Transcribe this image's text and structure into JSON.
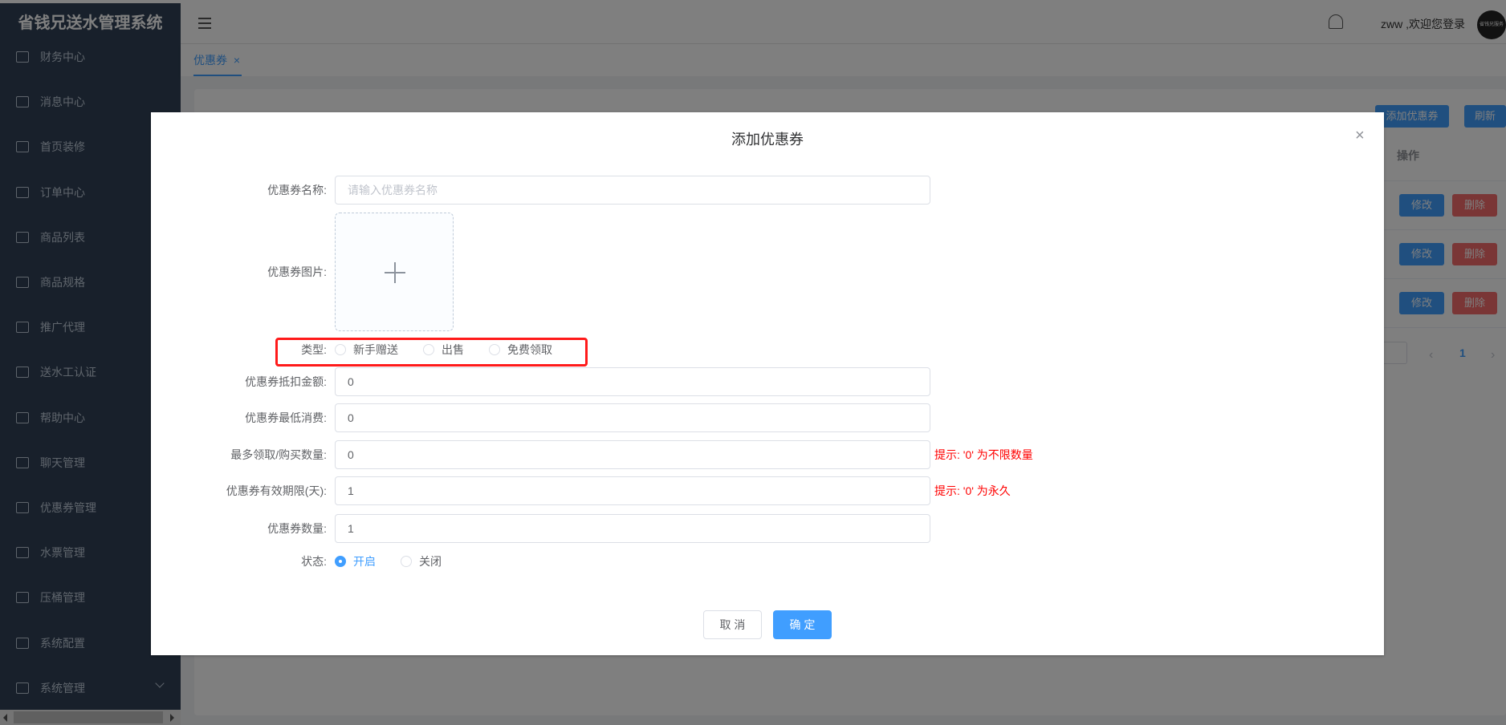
{
  "app_title": "省钱兄送水管理系统",
  "sidebar": {
    "items": [
      {
        "label": "财务中心",
        "icon": "wallet-icon"
      },
      {
        "label": "消息中心",
        "icon": "message-icon"
      },
      {
        "label": "首页装修",
        "icon": "box-icon"
      },
      {
        "label": "订单中心",
        "icon": "document-icon"
      },
      {
        "label": "商品列表",
        "icon": "clipboard-icon"
      },
      {
        "label": "商品规格",
        "icon": "list-card-icon"
      },
      {
        "label": "推广代理",
        "icon": "trophy-icon"
      },
      {
        "label": "送水工认证",
        "icon": "box-icon"
      },
      {
        "label": "帮助中心",
        "icon": "list-icon"
      },
      {
        "label": "聊天管理",
        "icon": "message-icon"
      },
      {
        "label": "优惠券管理",
        "icon": "ticket-icon"
      },
      {
        "label": "水票管理",
        "icon": "list-card-icon"
      },
      {
        "label": "压桶管理",
        "icon": "grid-icon"
      },
      {
        "label": "系统配置",
        "icon": "list-icon"
      },
      {
        "label": "系统管理",
        "icon": "list-icon"
      }
    ]
  },
  "header": {
    "user_greeting": "zww ,欢迎您登录",
    "avatar_text": "省钱兄服务"
  },
  "tabs": [
    {
      "label": "优惠券",
      "close": "×"
    }
  ],
  "background": {
    "add_button": "添加优惠券",
    "refresh_button": "刷新",
    "op_header": "操作",
    "rows": [
      {
        "edit": "修改",
        "delete": "删除"
      },
      {
        "edit": "修改",
        "delete": "删除"
      },
      {
        "edit": "修改",
        "delete": "删除"
      }
    ],
    "pagination": {
      "current_page": "1"
    }
  },
  "dialog": {
    "title": "添加优惠券",
    "fields": {
      "name": {
        "label": "优惠券名称:",
        "placeholder": "请输入优惠券名称",
        "value": ""
      },
      "image": {
        "label": "优惠券图片:"
      },
      "type": {
        "label": "类型:",
        "options": [
          "新手赠送",
          "出售",
          "免费领取"
        ],
        "selected": null
      },
      "amount": {
        "label": "优惠券抵扣金额:",
        "value": "0"
      },
      "min_spend": {
        "label": "优惠券最低消费:",
        "value": "0"
      },
      "max_qty": {
        "label": "最多领取/购买数量:",
        "value": "0",
        "hint": "提示: '0' 为不限数量"
      },
      "validity": {
        "label": "优惠券有效期限(天):",
        "value": "1",
        "hint": "提示: '0' 为永久"
      },
      "count": {
        "label": "优惠券数量:",
        "value": "1"
      },
      "status": {
        "label": "状态:",
        "options": [
          "开启",
          "关闭"
        ],
        "selected": "开启"
      }
    },
    "cancel": "取 消",
    "confirm": "确 定"
  },
  "colors": {
    "primary": "#409eff",
    "danger": "#f56c6c",
    "highlight": "#ff1a1a",
    "sidebar": "#304156"
  }
}
